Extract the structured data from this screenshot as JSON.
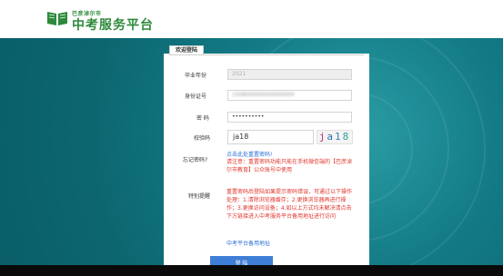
{
  "header": {
    "logo_sub": "巴彦淖尔市",
    "logo_main": "中考服务平台",
    "icon": "open-book-icon",
    "brand_color": "#2d8a3b"
  },
  "panel": {
    "tab_label": "欢迎登陆",
    "fields": {
      "year_label": "毕业年份",
      "year_value": "2021",
      "id_label": "身份证号",
      "id_value": "150800000000000000",
      "password_label": "密 码",
      "password_value": "••••••••••",
      "captcha_label": "校验码",
      "captcha_value": "ja18",
      "captcha_image_text": [
        "j",
        "a",
        "1",
        "8"
      ]
    },
    "forgot": {
      "label": "忘记密码?",
      "link": "点击此处重置密码!",
      "note": "请注意：重置密码功能只能在手机微信端的【巴彦淖尔市教育】公众账号中使用"
    },
    "notice": {
      "label": "特别提醒",
      "text": "重置密码后登陆如果提示密码错误，可通过以下操作处理：1.清除浏览器缓存；2.更换浏览器再进行操作；3.更换访问设备；4.如以上方式均未解决请点击下方链接进入中考服务平台备用地址进行访问",
      "backup_link": "中考平台备用地址"
    },
    "login_button": "登 陆"
  },
  "colors": {
    "link": "#2a6fd6",
    "warning": "#e0352b",
    "button": "#3f7ed6",
    "background": "#137b86"
  }
}
